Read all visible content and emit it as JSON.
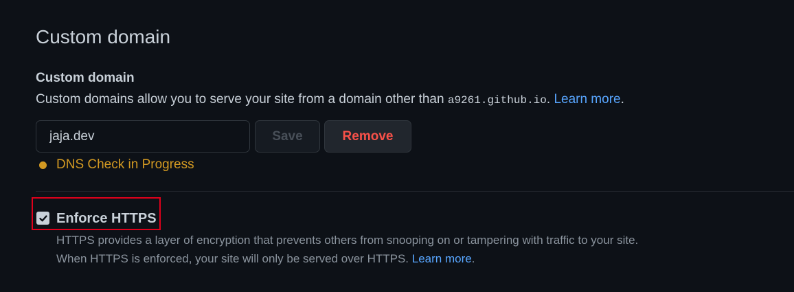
{
  "section": {
    "title": "Custom domain"
  },
  "custom_domain": {
    "label": "Custom domain",
    "description_prefix": "Custom domains allow you to serve your site from a domain other than ",
    "default_domain": "a9261.github.io",
    "description_suffix": ". ",
    "learn_more": "Learn more",
    "trailing_period": ".",
    "input_value": "jaja.dev",
    "save_label": "Save",
    "remove_label": "Remove",
    "status_text": "DNS Check in Progress"
  },
  "enforce_https": {
    "checked": true,
    "label": "Enforce HTTPS",
    "description_line1": "HTTPS provides a layer of encryption that prevents others from snooping on or tampering with traffic to your site.",
    "description_line2_prefix": "When HTTPS is enforced, your site will only be served over HTTPS. ",
    "learn_more": "Learn more",
    "trailing_period": "."
  },
  "colors": {
    "background": "#0d1117",
    "text": "#c9d1d9",
    "muted": "#8b949e",
    "link": "#58a6ff",
    "danger": "#f85149",
    "warning": "#d29922",
    "highlight_border": "#e0001b"
  }
}
